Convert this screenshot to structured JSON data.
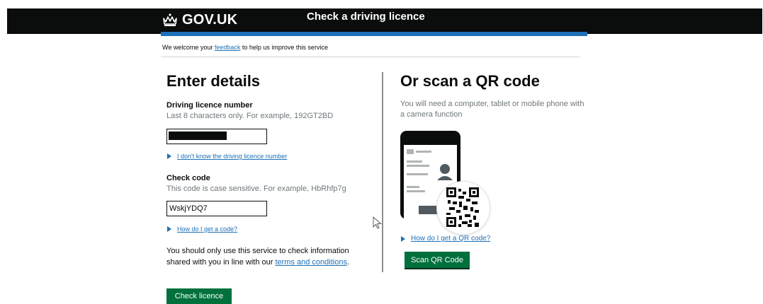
{
  "header": {
    "logo_text": "GOV.UK",
    "service_name": "Check a driving licence",
    "brand_colors": {
      "bar": "#0b0c0c",
      "rule": "#1d70b8"
    }
  },
  "feedback": {
    "prefix": "We welcome your ",
    "link": "feedback",
    "suffix": " to help us improve this service"
  },
  "form": {
    "heading": "Enter details",
    "licence": {
      "label": "Driving licence number",
      "hint": "Last 8 characters only. For example, 192GT2BD",
      "value_redacted": true
    },
    "dont_know_link": "I don't know the driving licence number",
    "check_code": {
      "label": "Check code",
      "hint": "This code is case sensitive. For example, HbRhfp7g",
      "value": "WskjYDQ7"
    },
    "how_get_code_link": "How do I get a code?",
    "notice": {
      "text": "You should only use this service to check information shared with you in line with our ",
      "link": "terms and conditions",
      "end": "."
    },
    "submit_label": "Check licence"
  },
  "qr": {
    "heading": "Or scan a QR code",
    "hint": "You will need a computer, tablet or mobile phone with a camera function",
    "how_get_link": "How do I get a QR code?",
    "button_label": "Scan QR Code",
    "button_color": "#00703c"
  }
}
